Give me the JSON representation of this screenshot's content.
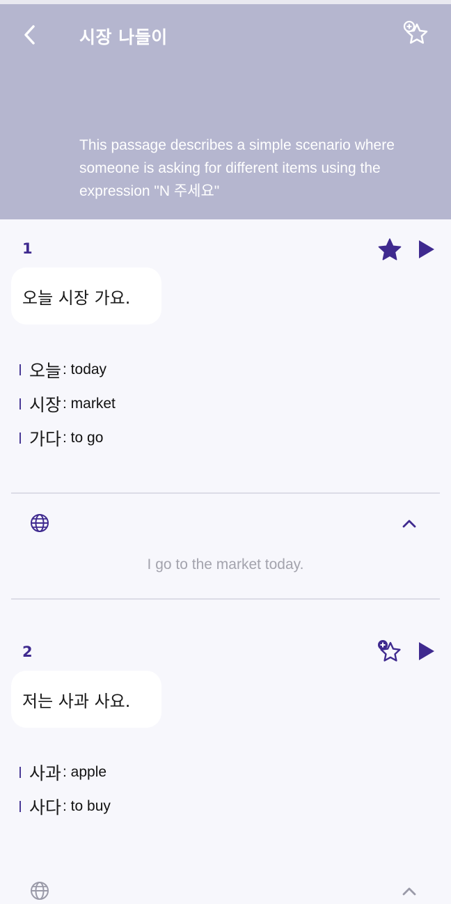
{
  "header": {
    "title": "시장 나들이",
    "description": "This passage describes a simple scenario where someone is asking for different items using the expression \"N 주세요\""
  },
  "colors": {
    "header_bg": "#b5b6cf",
    "accent": "#3f2a8f",
    "page_bg": "#f7f7fc",
    "translation_text": "#a3a3ad"
  },
  "icons": {
    "back": "chevron-left-icon",
    "favorite_header": "star-add-outline-icon",
    "favorited": "star-filled-icon",
    "add_favorite": "star-add-outline-icon",
    "play": "play-icon",
    "translate": "globe-icon",
    "collapse": "chevron-up-icon"
  },
  "sentences": [
    {
      "number": "1",
      "text": "오늘 시장 가요.",
      "favorited": true,
      "vocab": [
        {
          "word": "오늘",
          "meaning": ": today"
        },
        {
          "word": "시장",
          "meaning": ": market"
        },
        {
          "word": "가다",
          "meaning": ": to go"
        }
      ],
      "translation": "I go to the market today.",
      "expanded": true
    },
    {
      "number": "2",
      "text": "저는 사과 사요.",
      "favorited": false,
      "vocab": [
        {
          "word": "사과",
          "meaning": ": apple"
        },
        {
          "word": "사다",
          "meaning": ": to buy"
        }
      ]
    }
  ]
}
